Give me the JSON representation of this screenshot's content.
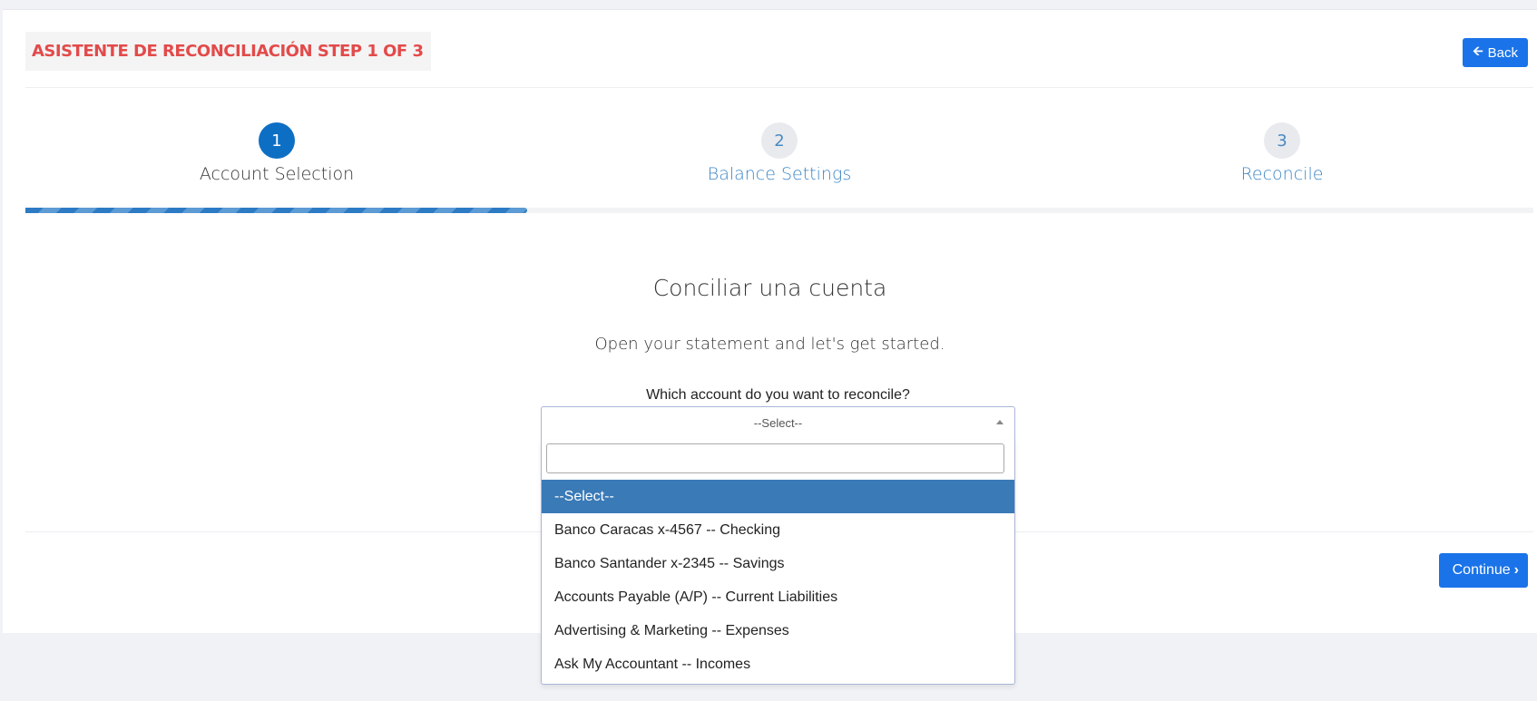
{
  "header": {
    "title": "ASISTENTE DE RECONCILIACIÓN STEP 1 OF 3",
    "back_label": "Back"
  },
  "steps": [
    {
      "number": "1",
      "label": "Account Selection",
      "state": "active"
    },
    {
      "number": "2",
      "label": "Balance Settings",
      "state": "inactive"
    },
    {
      "number": "3",
      "label": "Reconcile",
      "state": "inactive"
    }
  ],
  "progress": {
    "current_step": 1,
    "total_steps": 3,
    "fraction": 0.333
  },
  "main": {
    "heading": "Conciliar una cuenta",
    "subheading": "Open your statement and let's get started.",
    "question": "Which account do you want to reconcile?"
  },
  "account_select": {
    "selected": "--Select--",
    "search_value": "",
    "options": [
      "--Select--",
      "Banco Caracas x-4567 -- Checking",
      "Banco Santander x-2345 -- Savings",
      "Accounts Payable (A/P) -- Current Liabilities",
      "Advertising & Marketing -- Expenses",
      "Ask My Accountant -- Incomes"
    ],
    "highlighted_index": 0
  },
  "footer": {
    "continue_label": "Continue"
  },
  "colors": {
    "accent": "#1a73e8",
    "title_red": "#e34a4a",
    "highlight": "#3a7ab7",
    "step_active": "#0d6fc4"
  },
  "icons": {
    "back": "arrow-left-icon",
    "continue": "chevron-right-icon",
    "select": "caret-up-icon"
  }
}
